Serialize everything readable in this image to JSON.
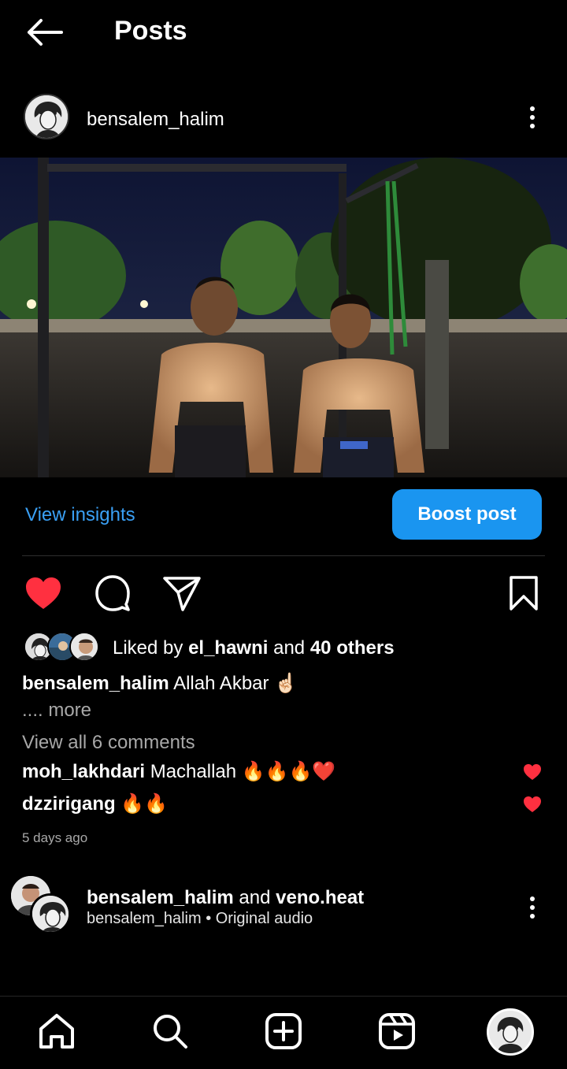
{
  "header": {
    "title": "Posts",
    "back_icon": "arrow-left-icon"
  },
  "post": {
    "username": "bensalem_halim",
    "menu_icon": "more-vertical-icon",
    "image": "photo of two shirtless men at an outdoor workout park at night"
  },
  "insights": {
    "view_label": "View insights",
    "boost_label": "Boost post"
  },
  "actions": {
    "like_icon": "heart-filled-icon",
    "comment_icon": "comment-icon",
    "share_icon": "send-icon",
    "save_icon": "bookmark-icon",
    "like_color": "#ff3040"
  },
  "likes": {
    "prefix": "Liked by",
    "user": "el_hawni",
    "conj": "and",
    "others": "40 others"
  },
  "caption": {
    "user": "bensalem_halim",
    "text": "Allah Akbar ☝🏻",
    "more": ".... more"
  },
  "comments": {
    "view_all": "View all 6 comments",
    "items": [
      {
        "user": "moh_lakhdari",
        "text": "Machallah 🔥🔥🔥❤️"
      },
      {
        "user": "dzzirigang",
        "text": "🔥🔥"
      }
    ]
  },
  "timestamp": "5 days ago",
  "audio": {
    "user1": "bensalem_halim",
    "conj": "and",
    "user2": "veno.heat",
    "subtitle": "bensalem_halim • Original audio"
  },
  "nav": {
    "items": [
      "home-icon",
      "search-icon",
      "create-post-icon",
      "reels-icon",
      "profile-avatar"
    ],
    "accent": "#1a95f0"
  }
}
